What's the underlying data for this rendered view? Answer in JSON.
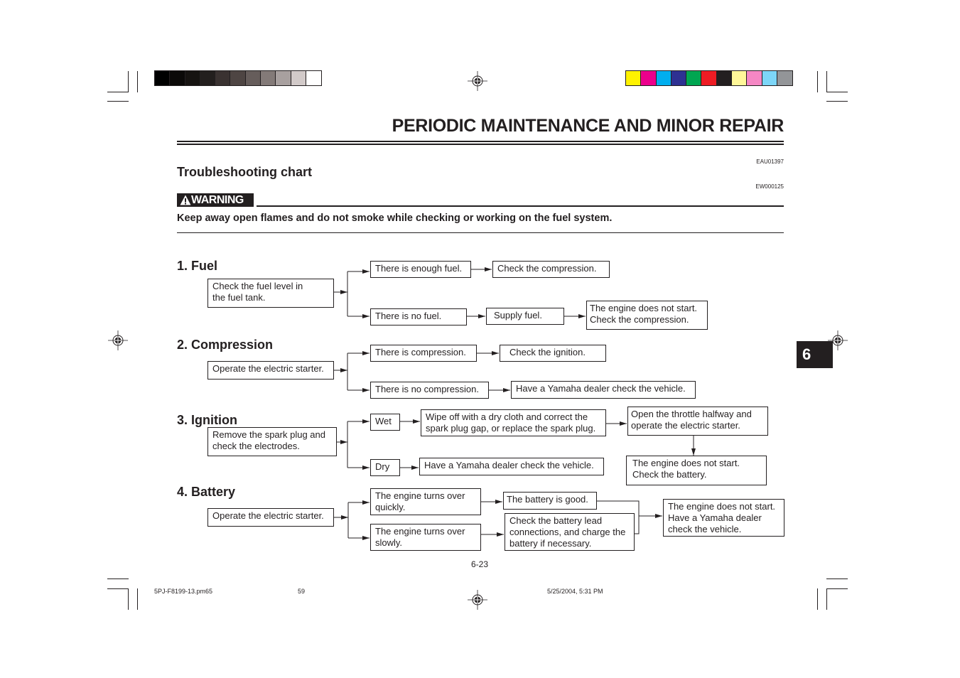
{
  "header": {
    "title": "PERIODIC MAINTENANCE AND MINOR REPAIR",
    "grayscale_swatches": [
      "#000000",
      "#0b0908",
      "#161311",
      "#231f1e",
      "#3a3231",
      "#4e4543",
      "#665d5b",
      "#837a78",
      "#a8a09f",
      "#d2cac9",
      "#ffffff"
    ],
    "color_swatches": [
      "#fff200",
      "#ec008c",
      "#00aeef",
      "#2e3192",
      "#00a651",
      "#ed1c24",
      "#231f20",
      "#fff799",
      "#f587c4",
      "#7dd6f8",
      "#939598"
    ]
  },
  "section": {
    "heading": "Troubleshooting chart",
    "code_top": "EAU01397",
    "code_warning": "EW000125",
    "warning_label": "WARNING",
    "warning_icon": "warning-triangle-icon",
    "warning_text": "Keep away open flames and do not smoke while checking or working on the fuel system."
  },
  "chart": {
    "fuel": {
      "title": "1. Fuel",
      "start": "Check the fuel level in\nthe fuel tank.",
      "yes": "There is enough fuel.",
      "yes_next": "Check the compression.",
      "no": "There is no fuel.",
      "no_next": "Supply fuel.",
      "no_final": "The engine does not start.\nCheck the compression."
    },
    "compression": {
      "title": "2. Compression",
      "start": "Operate the electric starter.",
      "yes": "There is compression.",
      "yes_next": "Check the ignition.",
      "no": "There is no compression.",
      "no_next": "Have a Yamaha dealer check the vehicle."
    },
    "ignition": {
      "title": "3. Ignition",
      "start": "Remove the spark plug and\ncheck the electrodes.",
      "wet": "Wet",
      "wet_next": "Wipe off with a dry cloth and correct the\nspark plug gap, or replace the spark plug.",
      "wet_then": "Open the throttle halfway and\noperate the electric starter.",
      "wet_final": "The engine does not start.\nCheck the battery.",
      "dry": "Dry",
      "dry_next": "Have a Yamaha dealer check the vehicle."
    },
    "battery": {
      "title": "4. Battery",
      "start": "Operate the electric starter.",
      "quick": "The engine turns over\nquickly.",
      "quick_next": "The battery is good.",
      "slow": "The engine turns over\nslowly.",
      "slow_next": "Check the battery lead\nconnections, and charge the\nbattery if necessary.",
      "final": "The engine does not start.\nHave a Yamaha dealer\ncheck the vehicle."
    }
  },
  "page_number": "6-23",
  "chapter_tab": "6",
  "footer": {
    "file": "5PJ-F8199-13.pm65",
    "page": "59",
    "timestamp": "5/25/2004, 5:31 PM"
  }
}
